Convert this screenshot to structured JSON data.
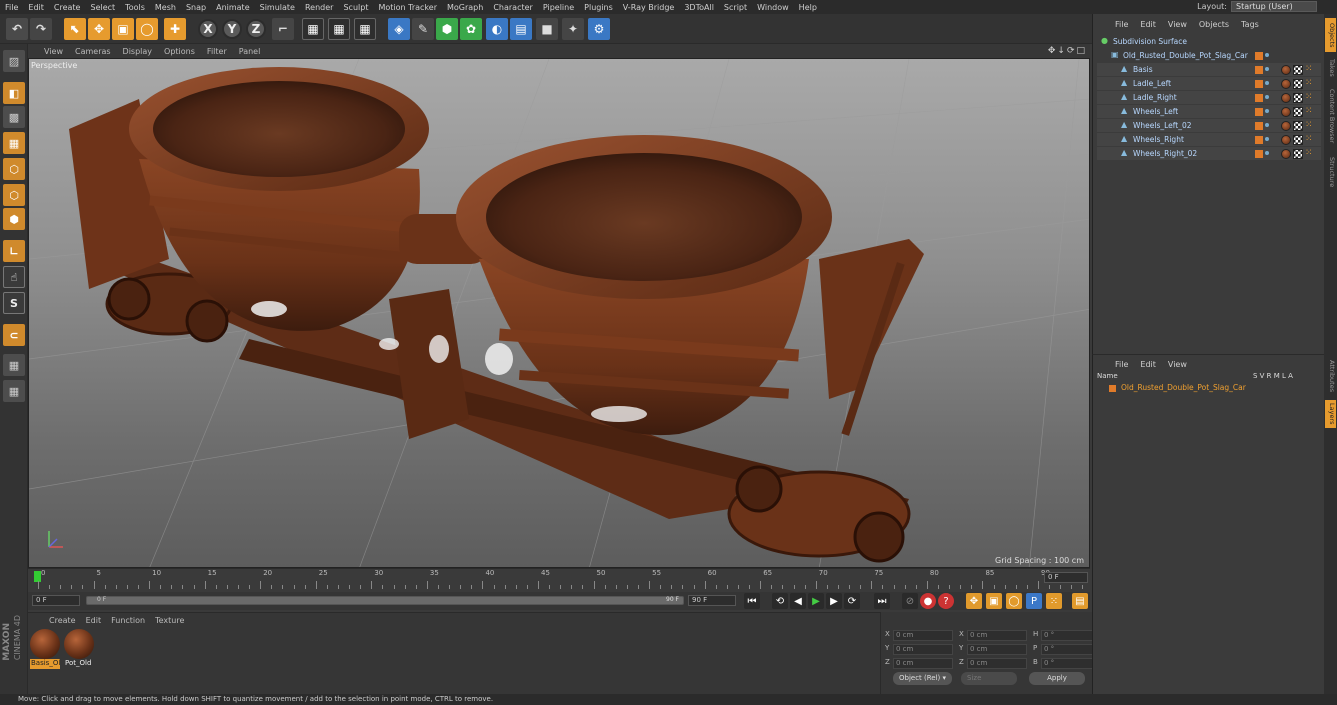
{
  "menubar": {
    "items": [
      "File",
      "Edit",
      "Create",
      "Select",
      "Tools",
      "Mesh",
      "Snap",
      "Animate",
      "Simulate",
      "Render",
      "Sculpt",
      "Motion Tracker",
      "MoGraph",
      "Character",
      "Pipeline",
      "Plugins",
      "V-Ray Bridge",
      "3DToAll",
      "Script",
      "Window",
      "Help"
    ],
    "layout_label": "Layout:",
    "layout_value": "Startup (User)"
  },
  "toolbar": {
    "axis_x": "X",
    "axis_y": "Y",
    "axis_z": "Z"
  },
  "viewport": {
    "menu": [
      "View",
      "Cameras",
      "Display",
      "Options",
      "Filter",
      "Panel"
    ],
    "label": "Perspective",
    "grid_spacing": "Grid Spacing : 100 cm",
    "icons": "✥↓⟳□"
  },
  "timeline": {
    "ticks": [
      "0",
      "5",
      "10",
      "15",
      "20",
      "25",
      "30",
      "35",
      "40",
      "45",
      "50",
      "55",
      "60",
      "65",
      "70",
      "75",
      "80",
      "85",
      "90"
    ],
    "end_frame": "0 F"
  },
  "transport": {
    "current_frame": "0 F",
    "slider_start": "0 F",
    "slider_end": "90 F",
    "max_frame": "90 F"
  },
  "material_manager": {
    "menu": [
      "Create",
      "Edit",
      "Function",
      "Texture"
    ],
    "materials": [
      {
        "label": "Basis_Ol"
      },
      {
        "label": "Pot_Old"
      }
    ]
  },
  "coordinates": {
    "rows": [
      {
        "a": "X",
        "av": "0 cm",
        "b": "X",
        "bv": "0 cm",
        "c": "H",
        "cv": "0 °"
      },
      {
        "a": "Y",
        "av": "0 cm",
        "b": "Y",
        "bv": "0 cm",
        "c": "P",
        "cv": "0 °"
      },
      {
        "a": "Z",
        "av": "0 cm",
        "b": "Z",
        "bv": "0 cm",
        "c": "B",
        "cv": "0 °"
      }
    ],
    "mode": "Object (Rel) ▾",
    "size": "Size",
    "apply": "Apply"
  },
  "objects": {
    "menu": [
      "File",
      "Edit",
      "View",
      "Objects",
      "Tags"
    ],
    "tree": [
      {
        "name": "Subdivision Surface",
        "indent": 0
      },
      {
        "name": "Old_Rusted_Double_Pot_Slag_Car",
        "indent": 1
      },
      {
        "name": "Basis",
        "indent": 2
      },
      {
        "name": "Ladle_Left",
        "indent": 2
      },
      {
        "name": "Ladle_Right",
        "indent": 2
      },
      {
        "name": "Wheels_Left",
        "indent": 2
      },
      {
        "name": "Wheels_Left_02",
        "indent": 2
      },
      {
        "name": "Wheels_Right",
        "indent": 2
      },
      {
        "name": "Wheels_Right_02",
        "indent": 2
      }
    ]
  },
  "layers": {
    "menu": [
      "File",
      "Edit",
      "View"
    ],
    "header_name": "Name",
    "header_cols": "S  V  R  M  L  A",
    "row": "Old_Rusted_Double_Pot_Slag_Car"
  },
  "right_tabs": [
    "Objects",
    "Takes",
    "Content Browser",
    "Structure",
    "Attributes",
    "Layers"
  ],
  "status": "Move: Click and drag to move elements. Hold down SHIFT to quantize movement / add to the selection in point mode, CTRL to remove.",
  "logo": {
    "line1": "MAXON",
    "line2": "CINEMA 4D"
  },
  "colors": {
    "accent": "#e69b2e",
    "rust": "#7a3a1c",
    "bg": "#3a3a3a"
  }
}
